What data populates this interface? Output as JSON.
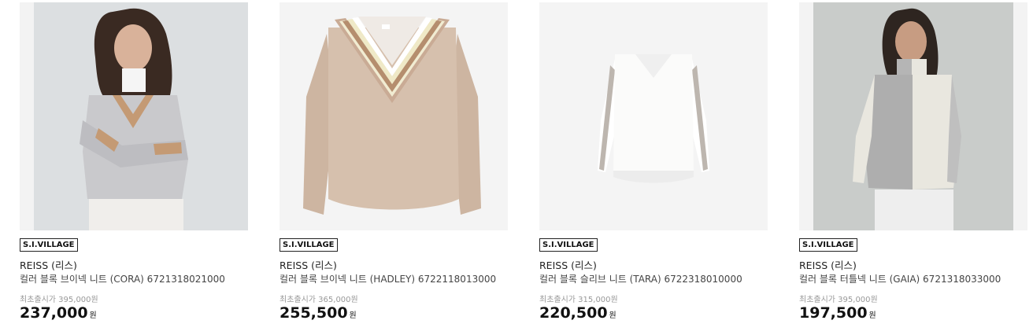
{
  "products": [
    {
      "badge": "S.I.VILLAGE",
      "brand": "REISS (리스)",
      "name": "컬러 블록 브이넥 니트 (CORA) 6721318021000",
      "original_price": "최초출시가 395,000원",
      "price": "237,000",
      "currency": "원",
      "image": "model-grey-vneck-sweater-photo"
    },
    {
      "badge": "S.I.VILLAGE",
      "brand": "REISS (리스)",
      "name": "컬러 블록 브이넥 니트 (HADLEY) 6722118013000",
      "original_price": "최초출시가 365,000원",
      "price": "255,500",
      "currency": "원",
      "image": "beige-striped-vneck-sweater-photo"
    },
    {
      "badge": "S.I.VILLAGE",
      "brand": "REISS (리스)",
      "name": "컬러 블록 슬리브 니트 (TARA) 6722318010000",
      "original_price": "최초출시가 315,000원",
      "price": "220,500",
      "currency": "원",
      "image": "white-sleeve-stripe-sweater-photo"
    },
    {
      "badge": "S.I.VILLAGE",
      "brand": "REISS (리스)",
      "name": "컬러 블록 터틀넥 니트 (GAIA) 6721318033000",
      "original_price": "최초출시가 395,000원",
      "price": "197,500",
      "currency": "원",
      "image": "model-grey-turtleneck-sweater-photo"
    }
  ]
}
